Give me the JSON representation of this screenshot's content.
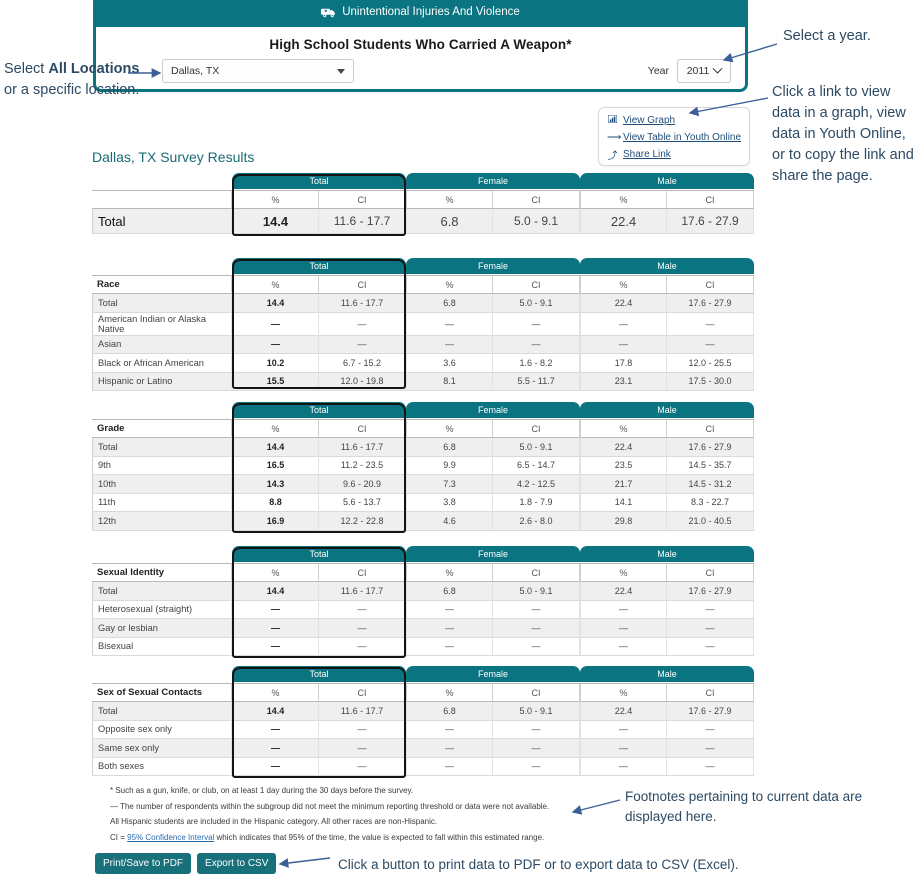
{
  "panel": {
    "category_title": "Unintentional Injuries And Violence",
    "category_icon": "ambulance-icon",
    "question_title": "High School Students Who Carried A Weapon*",
    "location_value": "Dallas, TX",
    "year_label": "Year",
    "year_value": "2011"
  },
  "links": {
    "view_graph": "View Graph",
    "view_table": "View Table in Youth Online",
    "share_link": "Share Link",
    "graph_icon": "bar-chart-icon",
    "table_icon": "arrow-right-icon",
    "share_icon": "share-arrow-icon"
  },
  "results_title": "Dallas, TX Survey Results",
  "colors": {
    "teal": "#0a7480",
    "button_teal": "#17707a",
    "title_text": "#1a6b73",
    "link": "#1f4e79",
    "annotation": "#2c4a63",
    "alt_row": "#efefef"
  },
  "column_groups": [
    "Total",
    "Female",
    "Male"
  ],
  "subheaders": [
    "%",
    "CI"
  ],
  "tables": [
    {
      "row_header": "",
      "rows": [
        {
          "label": "Total",
          "cells": [
            "14.4",
            "11.6 - 17.7",
            "6.8",
            "5.0 - 9.1",
            "22.4",
            "17.6 - 27.9"
          ]
        }
      ]
    },
    {
      "row_header": "Race",
      "rows": [
        {
          "label": "Total",
          "cells": [
            "14.4",
            "11.6 - 17.7",
            "6.8",
            "5.0 - 9.1",
            "22.4",
            "17.6 - 27.9"
          ]
        },
        {
          "label": "American Indian or Alaska Native",
          "cells": [
            "—",
            "—",
            "—",
            "—",
            "—",
            "—"
          ]
        },
        {
          "label": "Asian",
          "cells": [
            "—",
            "—",
            "—",
            "—",
            "—",
            "—"
          ]
        },
        {
          "label": "Black or African American",
          "cells": [
            "10.2",
            "6.7 - 15.2",
            "3.6",
            "1.6 - 8.2",
            "17.8",
            "12.0 - 25.5"
          ]
        },
        {
          "label": "Hispanic or Latino",
          "cells": [
            "15.5",
            "12.0 - 19.8",
            "8.1",
            "5.5 - 11.7",
            "23.1",
            "17.5 - 30.0"
          ]
        }
      ]
    },
    {
      "row_header": "Grade",
      "rows": [
        {
          "label": "Total",
          "cells": [
            "14.4",
            "11.6 - 17.7",
            "6.8",
            "5.0 - 9.1",
            "22.4",
            "17.6 - 27.9"
          ]
        },
        {
          "label": "9th",
          "cells": [
            "16.5",
            "11.2 - 23.5",
            "9.9",
            "6.5 - 14.7",
            "23.5",
            "14.5 - 35.7"
          ]
        },
        {
          "label": "10th",
          "cells": [
            "14.3",
            "9.6 - 20.9",
            "7.3",
            "4.2 - 12.5",
            "21.7",
            "14.5 - 31.2"
          ]
        },
        {
          "label": "11th",
          "cells": [
            "8.8",
            "5.6 - 13.7",
            "3.8",
            "1.8 - 7.9",
            "14.1",
            "8.3 - 22.7"
          ]
        },
        {
          "label": "12th",
          "cells": [
            "16.9",
            "12.2 - 22.8",
            "4.6",
            "2.6 - 8.0",
            "29.8",
            "21.0 - 40.5"
          ]
        }
      ]
    },
    {
      "row_header": "Sexual Identity",
      "rows": [
        {
          "label": "Total",
          "cells": [
            "14.4",
            "11.6 - 17.7",
            "6.8",
            "5.0 - 9.1",
            "22.4",
            "17.6 - 27.9"
          ]
        },
        {
          "label": "Heterosexual (straight)",
          "cells": [
            "—",
            "—",
            "—",
            "—",
            "—",
            "—"
          ]
        },
        {
          "label": "Gay or lesbian",
          "cells": [
            "—",
            "—",
            "—",
            "—",
            "—",
            "—"
          ]
        },
        {
          "label": "Bisexual",
          "cells": [
            "—",
            "—",
            "—",
            "—",
            "—",
            "—"
          ]
        }
      ]
    },
    {
      "row_header": "Sex of Sexual Contacts",
      "rows": [
        {
          "label": "Total",
          "cells": [
            "14.4",
            "11.6 - 17.7",
            "6.8",
            "5.0 - 9.1",
            "22.4",
            "17.6 - 27.9"
          ]
        },
        {
          "label": "Opposite sex only",
          "cells": [
            "—",
            "—",
            "—",
            "—",
            "—",
            "—"
          ]
        },
        {
          "label": "Same sex only",
          "cells": [
            "—",
            "—",
            "—",
            "—",
            "—",
            "—"
          ]
        },
        {
          "label": "Both sexes",
          "cells": [
            "—",
            "—",
            "—",
            "—",
            "—",
            "—"
          ]
        }
      ]
    }
  ],
  "footnotes": {
    "f1": "* Such as a gun, knife, or club, on at least 1 day during the 30 days before the survey.",
    "f2": "— The number of respondents within the subgroup did not meet the minimum reporting threshold or data were not available.",
    "f3": "All Hispanic students are included in the Hispanic category. All other races are non-Hispanic.",
    "f4_prefix": "CI = ",
    "f4_link": "95% Confidence Interval",
    "f4_suffix": " which indicates that 95% of the time, the value is expected to fall within this estimated range."
  },
  "buttons": {
    "print_pdf": "Print/Save to PDF",
    "export_csv": "Export to CSV"
  },
  "annotations": {
    "location": "Select All Locations or a specific location.",
    "location_p1": "Select ",
    "location_b1": "All Locations",
    "location_p2": " or a specific location.",
    "year": "Select a year.",
    "links": "Click a link to view data in a graph, view data in Youth Online, or to copy the link and share the page.",
    "footnotes": "Footnotes pertaining to current data are displayed here.",
    "buttons": "Click a button to print data to PDF or to export data to CSV (Excel)."
  }
}
